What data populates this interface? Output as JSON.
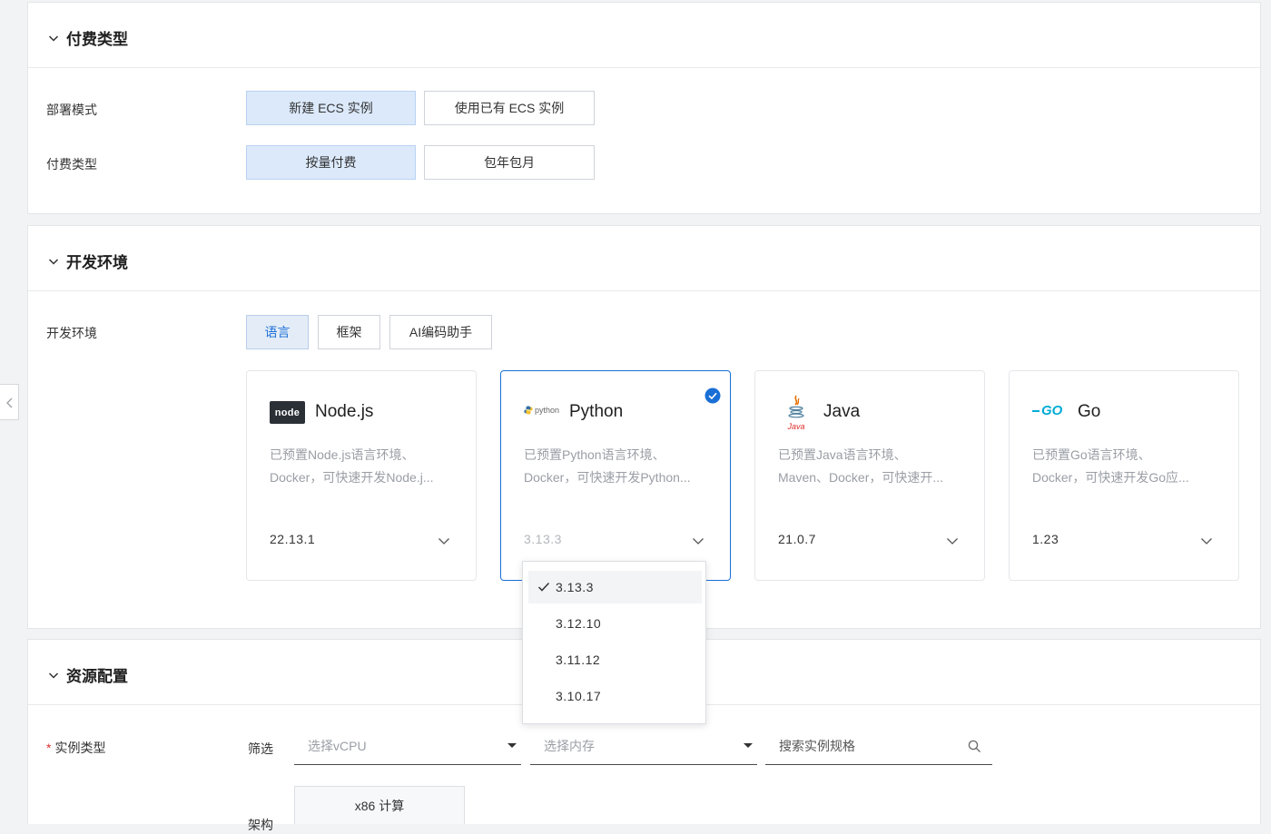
{
  "sections": {
    "billing": {
      "title": "付费类型",
      "deploy_mode_label": "部署模式",
      "deploy_options": [
        "新建 ECS 实例",
        "使用已有 ECS 实例"
      ],
      "billing_label": "付费类型",
      "billing_options": [
        "按量付费",
        "包年包月"
      ]
    },
    "devenv": {
      "title": "开发环境",
      "label": "开发环境",
      "tabs": [
        "语言",
        "框架",
        "AI编码助手"
      ],
      "cards": [
        {
          "name": "Node.js",
          "desc1": "已预置Node.js语言环境、",
          "desc2": "Docker，可快速开发Node.j...",
          "version": "22.13.1",
          "logo_text": "node"
        },
        {
          "name": "Python",
          "desc1": "已预置Python语言环境、",
          "desc2": "Docker，可快速开发Python...",
          "version": "3.13.3",
          "logo_text": "python"
        },
        {
          "name": "Java",
          "desc1": "已预置Java语言环境、",
          "desc2": "Maven、Docker，可快速开...",
          "version": "21.0.7",
          "logo_text": "Java"
        },
        {
          "name": "Go",
          "desc1": "已预置Go语言环境、",
          "desc2": "Docker，可快速开发Go应...",
          "version": "1.23",
          "logo_text": "GO"
        }
      ],
      "python_versions": [
        "3.13.3",
        "3.12.10",
        "3.11.12",
        "3.10.17"
      ]
    },
    "resource": {
      "title": "资源配置",
      "instance_label": "实例类型",
      "required_mark": "*",
      "filter_label": "筛选",
      "vcpu_placeholder": "选择vCPU",
      "memory_placeholder": "选择内存",
      "search_placeholder": "搜索实例规格",
      "arch_label": "架构",
      "arch_option": "x86 计算"
    }
  },
  "colors": {
    "accent": "#1a6fd6",
    "active_bg": "#dbe9fb",
    "required": "#e0302c"
  }
}
